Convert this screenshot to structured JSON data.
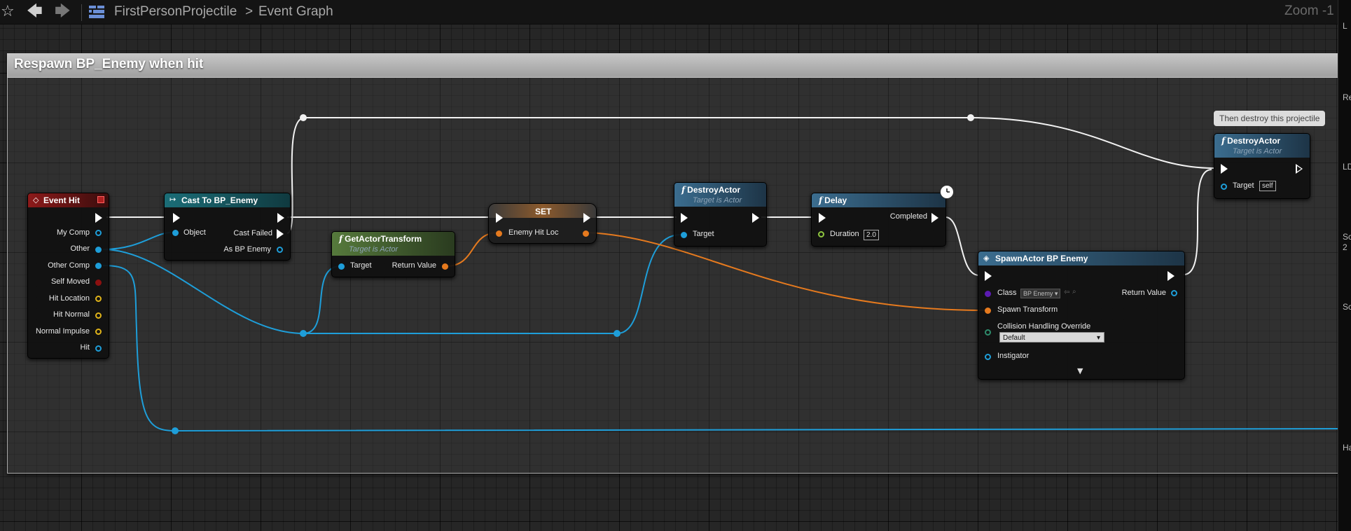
{
  "toolbar": {
    "breadcrumb_root": "FirstPersonProjectile",
    "breadcrumb_sep": ">",
    "breadcrumb_leaf": "Event Graph",
    "zoom": "Zoom -1"
  },
  "comment": {
    "title": "Respawn BP_Enemy when hit"
  },
  "tooltip": "Then destroy this projectile",
  "nodes": {
    "event_hit": {
      "title": "Event Hit",
      "pins": [
        "My Comp",
        "Other",
        "Other Comp",
        "Self Moved",
        "Hit Location",
        "Hit Normal",
        "Normal Impulse",
        "Hit"
      ]
    },
    "cast": {
      "title": "Cast To BP_Enemy",
      "object": "Object",
      "cast_failed": "Cast Failed",
      "as_enemy": "As BP Enemy"
    },
    "get_transform": {
      "title": "GetActorTransform",
      "subtitle": "Target is Actor",
      "target": "Target",
      "return_value": "Return Value"
    },
    "set": {
      "title": "SET",
      "var": "Enemy Hit Loc"
    },
    "destroy1": {
      "title": "DestroyActor",
      "subtitle": "Target is Actor",
      "target": "Target"
    },
    "delay": {
      "title": "Delay",
      "completed": "Completed",
      "duration": "Duration",
      "duration_value": "2.0"
    },
    "spawn": {
      "title": "SpawnActor BP Enemy",
      "class": "Class",
      "class_value": "BP Enemy",
      "return_value": "Return Value",
      "spawn_transform": "Spawn Transform",
      "collision": "Collision Handling Override",
      "collision_value": "Default",
      "instigator": "Instigator"
    },
    "destroy2": {
      "title": "DestroyActor",
      "subtitle": "Target is Actor",
      "target": "Target",
      "target_value": "self"
    }
  },
  "sidebar_letters": [
    "L",
    "Re",
    "LD",
    "Sc",
    "2",
    "Sc",
    "Ha"
  ],
  "colors": {
    "exec": "#ffffff",
    "object": "#1e9ed9",
    "struct": "#e67a1e",
    "vector": "#e0b41a",
    "bool": "#8c1010",
    "float": "#8ec63f",
    "class": "#5b1bb1"
  }
}
